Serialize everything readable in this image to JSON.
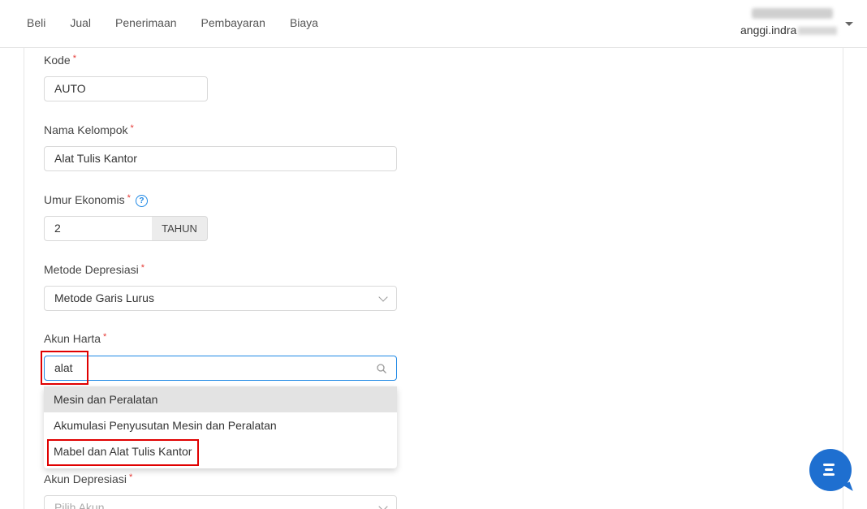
{
  "nav": {
    "items": [
      "Beli",
      "Jual",
      "Penerimaan",
      "Pembayaran",
      "Biaya"
    ]
  },
  "user": {
    "email_visible": "anggi.indra"
  },
  "form": {
    "kode": {
      "label": "Kode",
      "value": "AUTO"
    },
    "nama_kelompok": {
      "label": "Nama Kelompok",
      "value": "Alat Tulis Kantor"
    },
    "umur_ekonomis": {
      "label": "Umur Ekonomis",
      "value": "2",
      "unit": "TAHUN"
    },
    "metode_depresiasi": {
      "label": "Metode Depresiasi",
      "value": "Metode Garis Lurus"
    },
    "akun_harta": {
      "label": "Akun Harta",
      "value": "alat",
      "options": [
        "Mesin dan Peralatan",
        "Akumulasi Penyusutan Mesin dan Peralatan",
        "Mabel dan Alat Tulis Kantor"
      ]
    },
    "akun_depresiasi": {
      "label": "Akun Depresiasi",
      "placeholder": "Pilih Akun"
    },
    "required_mark": "*",
    "help_mark": "?"
  },
  "colors": {
    "accent": "#1e88e5",
    "highlight": "#e00000",
    "required": "#e53935",
    "chat": "#1e6fd0"
  },
  "icons": [
    "help-icon",
    "chevron-down-icon",
    "search-icon",
    "chat-icon",
    "caret-down-icon"
  ]
}
